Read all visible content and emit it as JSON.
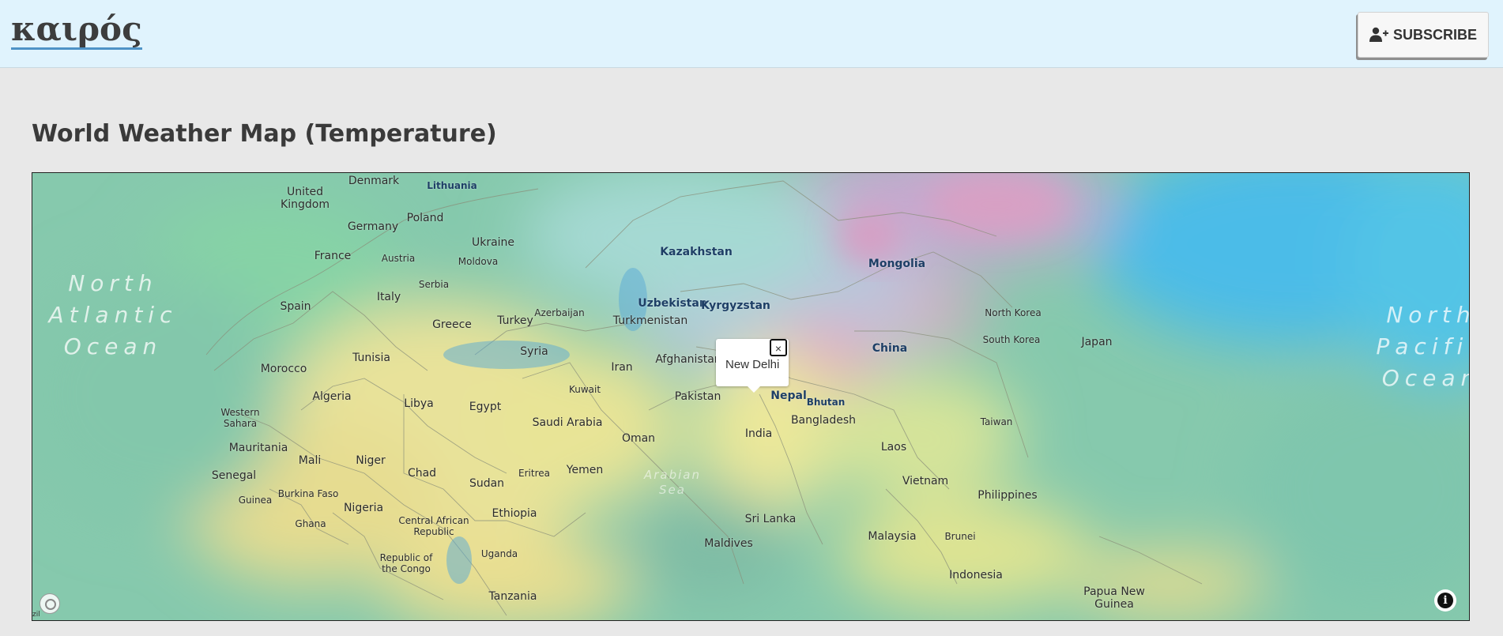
{
  "header": {
    "logo": "καιρός",
    "subscribe_label": "SUBSCRIBE"
  },
  "page": {
    "title": "World Weather Map (Temperature)"
  },
  "map": {
    "layer": "temperature",
    "popup": {
      "text": "New Delhi",
      "close": "×"
    },
    "attribution": "zil",
    "oceans": {
      "north_atlantic": "North\nAtlantic\nOcean",
      "north_pacific": "North\nPacific\nOcean",
      "arabian_sea": "Arabian\nSea"
    },
    "labels": {
      "denmark": "Denmark",
      "lithuania": "Lithuania",
      "united_kingdom": "United\nKingdom",
      "poland": "Poland",
      "germany": "Germany",
      "ukraine": "Ukraine",
      "france": "France",
      "austria": "Austria",
      "moldova": "Moldova",
      "kazakhstan": "Kazakhstan",
      "mongolia": "Mongolia",
      "serbia": "Serbia",
      "spain": "Spain",
      "italy": "Italy",
      "uzbekistan": "Uzbekistan",
      "kyrgyzstan": "Kyrgyzstan",
      "azerbaijan": "Azerbaijan",
      "turkey": "Turkey",
      "turkmenistan": "Turkmenistan",
      "greece": "Greece",
      "north_korea": "North Korea",
      "south_korea": "South Korea",
      "japan": "Japan",
      "china": "China",
      "syria": "Syria",
      "tunisia": "Tunisia",
      "morocco": "Morocco",
      "iran": "Iran",
      "afghanistan": "Afghanistan",
      "kuwait": "Kuwait",
      "pakistan": "Pakistan",
      "nepal": "Nepal",
      "bhutan": "Bhutan",
      "algeria": "Algeria",
      "libya": "Libya",
      "egypt": "Egypt",
      "western_sahara": "Western\nSahara",
      "saudi_arabia": "Saudi Arabia",
      "bangladesh": "Bangladesh",
      "taiwan": "Taiwan",
      "india": "India",
      "oman": "Oman",
      "mauritania": "Mauritania",
      "laos": "Laos",
      "mali": "Mali",
      "niger": "Niger",
      "chad": "Chad",
      "eritrea": "Eritrea",
      "yemen": "Yemen",
      "vietnam": "Vietnam",
      "senegal": "Senegal",
      "sudan": "Sudan",
      "burkina_faso": "Burkina Faso",
      "philippines": "Philippines",
      "guinea": "Guinea",
      "nigeria": "Nigeria",
      "ethiopia": "Ethiopia",
      "central_african_republic": "Central African\nRepublic",
      "sri_lanka": "Sri Lanka",
      "ghana": "Ghana",
      "malaysia": "Malaysia",
      "brunei": "Brunei",
      "maldives": "Maldives",
      "republic_of_the_congo": "Republic of\nthe Congo",
      "uganda": "Uganda",
      "indonesia": "Indonesia",
      "papua_new_guinea": "Papua New\nGuinea",
      "tanzania": "Tanzania"
    }
  }
}
